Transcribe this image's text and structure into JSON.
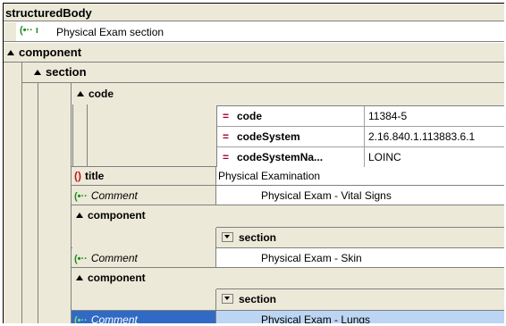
{
  "tree": {
    "root": "structuredBody",
    "root_comment": "Physical Exam section",
    "component": "component",
    "section": "section",
    "code_node": "code",
    "attrs": [
      {
        "name": "code",
        "value": "11384-5"
      },
      {
        "name": "codeSystem",
        "value": "2.16.840.1.113883.6.1"
      },
      {
        "name": "codeSystemNa...",
        "value": "LOINC"
      }
    ],
    "title_label": "title",
    "title_value": "Physical Examination",
    "comment_label": "Comment",
    "comment_vitals": "Physical Exam  - Vital Signs",
    "component2": "component",
    "section2": "section",
    "comment_skin": "Physical Exam  - Skin",
    "component3": "component",
    "section3": "section",
    "comment_lungs": "Physical Exam  - Lungs"
  },
  "icons": {
    "comment": "comment-icon",
    "attribute": "attribute-icon",
    "element": "element-icon",
    "expand": "collapse-triangle-icon",
    "dropdown": "dropdown-icon"
  },
  "colors": {
    "selection": "#316ac5",
    "selection_value": "#bcd5f3",
    "comment_icon": "#1b8c1b",
    "attribute_icon": "#a0002a"
  }
}
